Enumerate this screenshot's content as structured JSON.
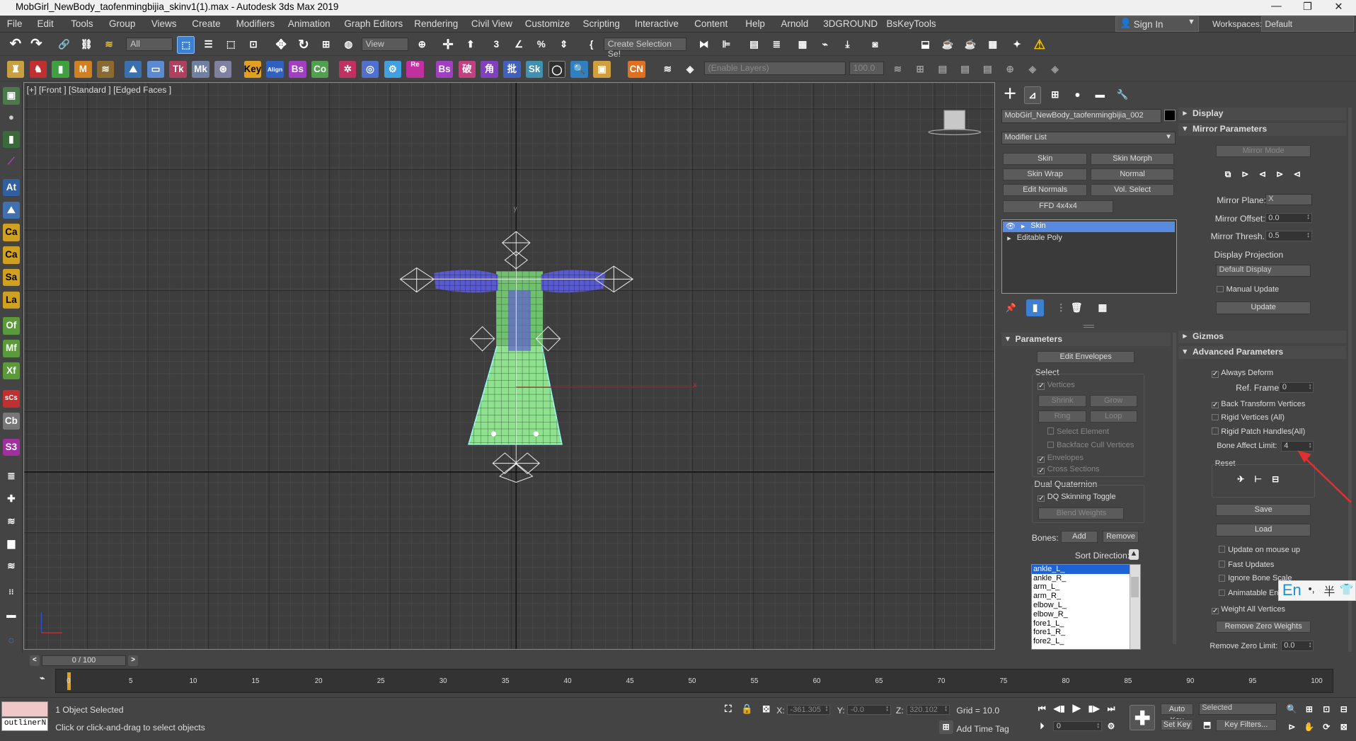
{
  "window": {
    "title": "MobGirl_NewBody_taofenmingbijia_skinv1(1).max - Autodesk 3ds Max 2019",
    "minimize": "—",
    "restore": "❐",
    "close": "✕"
  },
  "menu": [
    "File",
    "Edit",
    "Tools",
    "Group",
    "Views",
    "Create",
    "Modifiers",
    "Animation",
    "Graph Editors",
    "Rendering",
    "Civil View",
    "Customize",
    "Scripting",
    "Interactive",
    "Content",
    "Help",
    "Arnold",
    "3DGROUND",
    "BsKeyTools"
  ],
  "signin": "Sign In",
  "workspaces_label": "Workspaces:",
  "workspace": "Default",
  "toolbar1": {
    "filter": "All",
    "refcoord": "View",
    "selset": "Create Selection Se!"
  },
  "toolbar2": {
    "enable_layers": "(Enable Layers)",
    "layer_value": "100.0"
  },
  "tb2_icons": [
    "Key",
    "Align",
    "Bs",
    "Co",
    "Re",
    "Bs",
    "破",
    "角",
    "批",
    "CN"
  ],
  "left_icons": [
    "At",
    "Ca",
    "Ca",
    "Sa",
    "La",
    "Of",
    "Mf",
    "Xf",
    "sCs",
    "Cb",
    "S3"
  ],
  "viewport": {
    "label": "[+] [Front ] [Standard ] [Edged Faces ]",
    "axis_y": "y",
    "axis_x": "x"
  },
  "cmd": {
    "object_name": "MobGirl_NewBody_taofenmingbijia_002",
    "modifier_list": "Modifier List",
    "mod_buttons": [
      "Skin",
      "Skin Morph",
      "Skin Wrap",
      "Normal",
      "Edit Normals",
      "Vol. Select",
      "FFD 4x4x4"
    ],
    "stack": [
      "Skin",
      "Editable Poly"
    ]
  },
  "params": {
    "title": "Parameters",
    "edit_envelopes": "Edit Envelopes",
    "select": "Select",
    "vertices": "Vertices",
    "shrink": "Shrink",
    "grow": "Grow",
    "ring": "Ring",
    "loop": "Loop",
    "select_element": "Select Element",
    "backface": "Backface Cull Vertices",
    "envelopes": "Envelopes",
    "cross_sections": "Cross Sections",
    "dq": "Dual Quaternion",
    "dq_toggle": "DQ Skinning Toggle",
    "blend_weights": "Blend Weights",
    "bones_label": "Bones:",
    "add": "Add",
    "remove": "Remove",
    "sort": "Sort Direction:",
    "bones": [
      "ankle_L_",
      "ankle_R_",
      "arm_L_",
      "arm_R_",
      "elbow_L_",
      "elbow_R_",
      "fore1_L_",
      "fore1_R_",
      "fore2_L_"
    ]
  },
  "right": {
    "display": "Display",
    "mirror_params": "Mirror Parameters",
    "mirror_mode": "Mirror Mode",
    "mirror_plane_label": "Mirror Plane:",
    "mirror_plane": "X",
    "mirror_offset_label": "Mirror Offset:",
    "mirror_offset": "0.0",
    "mirror_thresh_label": "Mirror Thresh.:",
    "mirror_thresh": "0.5",
    "display_projection": "Display Projection",
    "default_display": "Default Display",
    "manual_update": "Manual Update",
    "update": "Update",
    "gizmos": "Gizmos",
    "advanced": "Advanced Parameters",
    "always_deform": "Always Deform",
    "ref_frame_label": "Ref. Frame:",
    "ref_frame": "0",
    "back_transform": "Back Transform Vertices",
    "rigid_vertices": "Rigid Vertices (All)",
    "rigid_patch": "Rigid Patch Handles(All)",
    "bone_affect_label": "Bone Affect Limit:",
    "bone_affect": "4",
    "reset": "Reset",
    "save": "Save",
    "load": "Load",
    "update_mouse": "Update on mouse up",
    "fast_updates": "Fast Updates",
    "ignore_bone": "Ignore Bone Scale",
    "animatable": "Animatable En",
    "weight_all": "Weight All Vertices",
    "remove_zero": "Remove Zero Weights",
    "remove_zero_limit_label": "Remove Zero Limit:",
    "remove_zero_limit": "0.0",
    "ime": "En"
  },
  "timeline": {
    "frame": "0 / 100",
    "ticks": [
      "0",
      "5",
      "10",
      "15",
      "20",
      "25",
      "30",
      "35",
      "40",
      "45",
      "50",
      "55",
      "60",
      "65",
      "70",
      "75",
      "80",
      "85",
      "90",
      "95",
      "100"
    ]
  },
  "status": {
    "maxscript": "outlinerN",
    "objects": "1 Object Selected",
    "prompt": "Click or click-and-drag to select objects",
    "x_label": "X:",
    "x": "-361.305",
    "y_label": "Y:",
    "y": "-0.0",
    "z_label": "Z:",
    "z": "320.102",
    "grid": "Grid = 10.0",
    "add_time_tag": "Add Time Tag",
    "auto_key": "Auto Key",
    "set_key": "Set Key",
    "selected": "Selected",
    "key_filters": "Key Filters...",
    "frame_field": "0"
  },
  "colors": {
    "accent": "#1e63d6",
    "arm": "#5a5ad0",
    "skirt": "#8fe08f",
    "arrow": "#e03030"
  }
}
